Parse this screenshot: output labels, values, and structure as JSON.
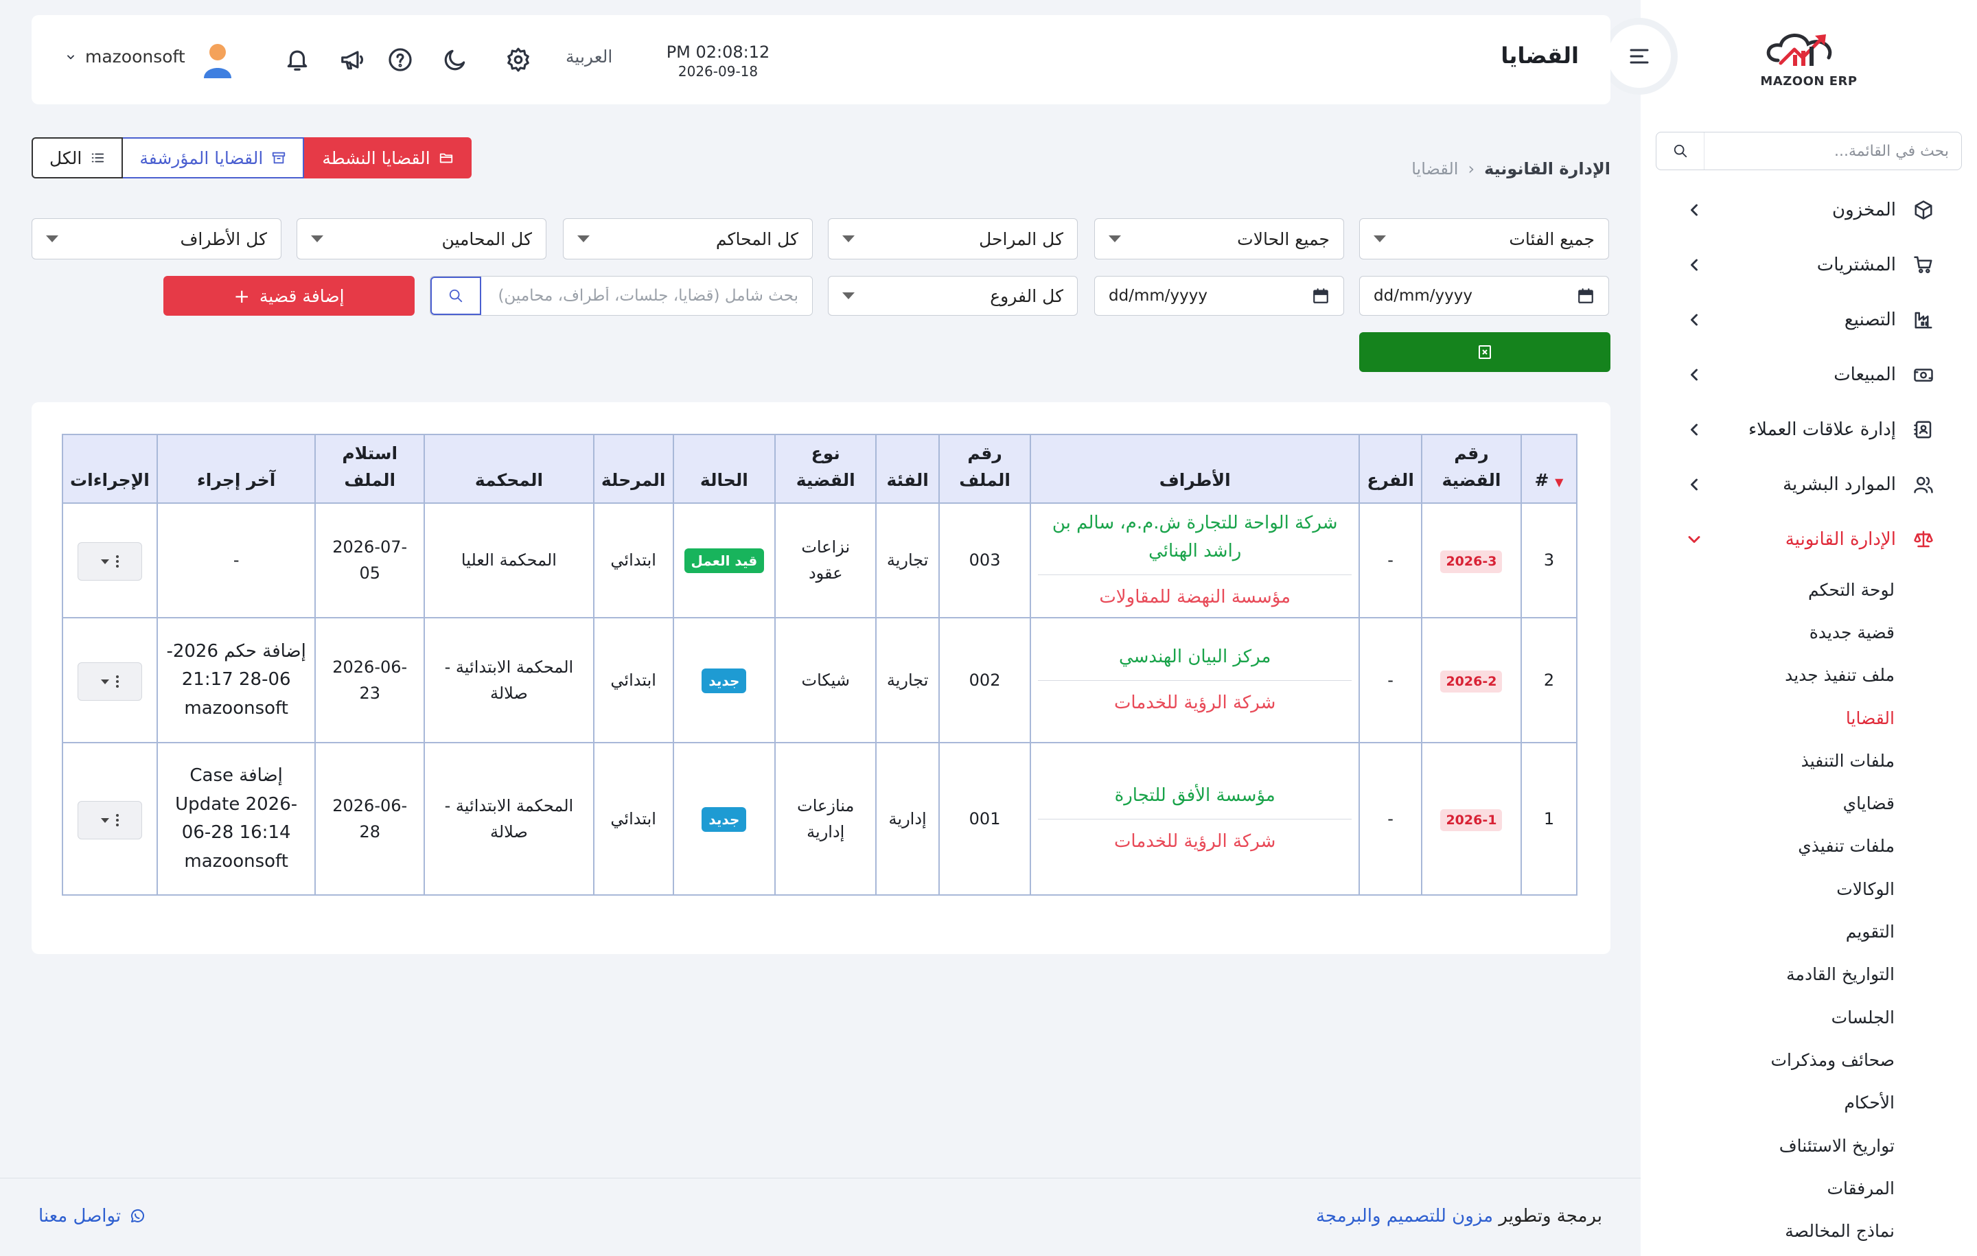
{
  "app": {
    "logo_text": "MAZOON ERP"
  },
  "header": {
    "title": "القضايا",
    "time": "PM 02:08:12",
    "date": "2026-09-18",
    "language": "العربية",
    "username": "mazoonsoft"
  },
  "sidebar": {
    "search_placeholder": "بحث في القائمة...",
    "items": [
      {
        "label": "المخزون",
        "icon": "cube-icon"
      },
      {
        "label": "المشتريات",
        "icon": "cart-icon"
      },
      {
        "label": "التصنيع",
        "icon": "factory-icon"
      },
      {
        "label": "المبيعات",
        "icon": "cash-icon"
      },
      {
        "label": "إدارة علاقات العملاء",
        "icon": "contacts-icon"
      },
      {
        "label": "الموارد البشرية",
        "icon": "users-icon"
      },
      {
        "label": "الإدارة القانونية",
        "icon": "scale-icon",
        "active": true
      }
    ],
    "legal_sub": [
      "لوحة التحكم",
      "قضية جديدة",
      "ملف تنفيذ جديد",
      "القضايا",
      "ملفات التنفيذ",
      "قضاياي",
      "ملفات تنفيذي",
      "الوكالات",
      "التقويم",
      "التواريخ القادمة",
      "الجلسات",
      "صحائف ومذكرات",
      "الأحكام",
      "تواريخ الاستئناف",
      "المرفقات",
      "نماذج المخالصة"
    ],
    "active_sub": "القضايا"
  },
  "breadcrumb": {
    "parent": "الإدارة القانونية",
    "current": "القضايا"
  },
  "tabs": {
    "active": "القضايا النشطة",
    "archived": "القضايا المؤرشفة",
    "all": "الكل"
  },
  "filters": {
    "categories": "جميع الفئات",
    "statuses": "جميع الحالات",
    "stages": "كل المراحل",
    "courts": "كل المحاكم",
    "lawyers": "كل المحامين",
    "parties": "كل الأطراف",
    "date_placeholder": "dd/mm/yyyy",
    "branches": "كل الفروع",
    "search_placeholder": "بحث شامل (قضايا، جلسات، أطراف، محامين)",
    "add_case": "إضافة قضية"
  },
  "table": {
    "headers": {
      "index": "#",
      "case_no": "رقم القضية",
      "branch": "الفرع",
      "parties": "الأطراف",
      "file_no": "رقم الملف",
      "category": "الفئة",
      "case_type": "نوع القضية",
      "status": "الحالة",
      "stage": "المرحلة",
      "court": "المحكمة",
      "received": "استلام الملف",
      "last_action": "آخر إجراء",
      "actions": "الإجراءات"
    },
    "rows": [
      {
        "index": "3",
        "case_no": "2026-3",
        "branch": "-",
        "party_a": "شركة الواحة للتجارة ش.م.م، سالم بن راشد الهنائي",
        "party_b": "مؤسسة النهضة للمقاولات",
        "file_no": "003",
        "category": "تجارية",
        "case_type": "نزاعات عقود",
        "status": "قيد العمل",
        "status_color": "#18b45c",
        "stage": "ابتدائي",
        "court": "المحكمة العليا",
        "received": "2026-07-05",
        "last_action": "-"
      },
      {
        "index": "2",
        "case_no": "2026-2",
        "branch": "-",
        "party_a": "مركز البيان الهندسي",
        "party_b": "شركة الرؤية للخدمات",
        "file_no": "002",
        "category": "تجارية",
        "case_type": "شيكات",
        "status": "جديد",
        "status_color": "#1e9bd3",
        "stage": "ابتدائي",
        "court": "المحكمة الابتدائية - صلالة",
        "received": "2026-06-23",
        "last_action": "إضافة حكم 2026-06-28 21:17 mazoonsoft"
      },
      {
        "index": "1",
        "case_no": "2026-1",
        "branch": "-",
        "party_a": "مؤسسة الأفق للتجارة",
        "party_b": "شركة الرؤية للخدمات",
        "file_no": "001",
        "category": "إدارية",
        "case_type": "منازعات إدارية",
        "status": "جديد",
        "status_color": "#1e9bd3",
        "stage": "ابتدائي",
        "court": "المحكمة الابتدائية - صلالة",
        "received": "2026-06-28",
        "last_action": "إضافة Case Update 2026-06-28 16:14 mazoonsoft"
      }
    ]
  },
  "footer": {
    "prefix": "برمجة وتطوير",
    "company": "مزون للتصميم والبرمجة",
    "contact": "تواصل معنا"
  },
  "colors": {
    "accent": "#e63a47",
    "archived": "#4a5fd0",
    "excel": "#15831d"
  }
}
